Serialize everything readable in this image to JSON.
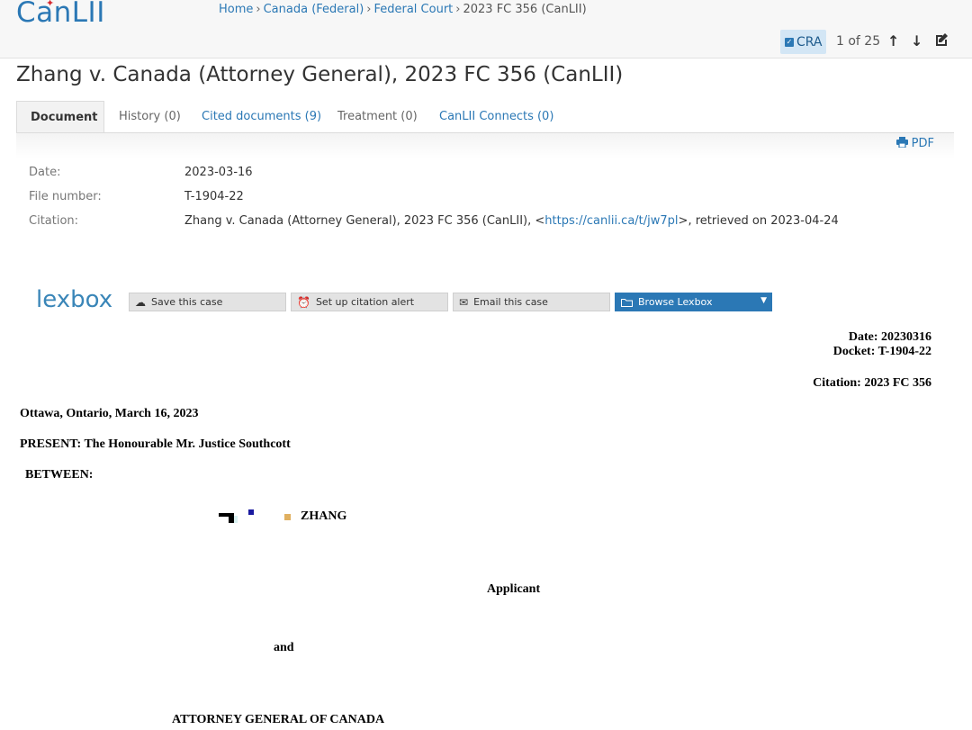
{
  "header": {
    "logo": "CanLII",
    "breadcrumb": {
      "home": "Home",
      "jurisdiction": "Canada (Federal)",
      "court": "Federal Court",
      "current": "2023 FC 356 (CanLII)",
      "separator": "›"
    },
    "search_term": "CRA",
    "hit_count": "1 of 25",
    "icons": [
      "arrow-up-icon",
      "arrow-down-icon",
      "edit-icon"
    ]
  },
  "page": {
    "title": "Zhang v. Canada (Attorney General), 2023 FC 356 (CanLII)"
  },
  "tabs": [
    {
      "label": "Document"
    },
    {
      "label": "History (0)"
    },
    {
      "label": "Cited documents (9)"
    },
    {
      "label": "Treatment (0)"
    },
    {
      "label": "CanLII Connects (0)"
    }
  ],
  "pdf_label": "PDF",
  "meta": {
    "date_label": "Date:",
    "date_value": "2023-03-16",
    "file_label": "File number:",
    "file_value": "T-1904-22",
    "citation_label": "Citation:",
    "citation_prefix": "Zhang v. Canada (Attorney General), 2023 FC 356 (CanLII), <",
    "citation_link": "https://canlii.ca/t/jw7pl",
    "citation_suffix": ">, retrieved on 2023-04-24"
  },
  "lexbox": {
    "logo": "lexbox",
    "save": "Save this case",
    "alert": "Set up citation alert",
    "email": "Email this case",
    "browse": "Browse Lexbox"
  },
  "document": {
    "date": "Date: 20230316",
    "docket": "Docket: T-1904-22",
    "citation": "Citation: 2023 FC 356",
    "place_date": "Ottawa, Ontario, March 16, 2023",
    "present": "PRESENT: The Honourable Mr. Justice Southcott",
    "between": "BETWEEN:",
    "applicant_name": "ZHANG",
    "applicant_role": "Applicant",
    "and": "and",
    "respondent_name": "ATTORNEY GENERAL OF CANADA"
  },
  "colors": {
    "brand": "#2b78b5",
    "logo_leaf": "#d6282f",
    "search_highlight": "#d3e6f5"
  }
}
